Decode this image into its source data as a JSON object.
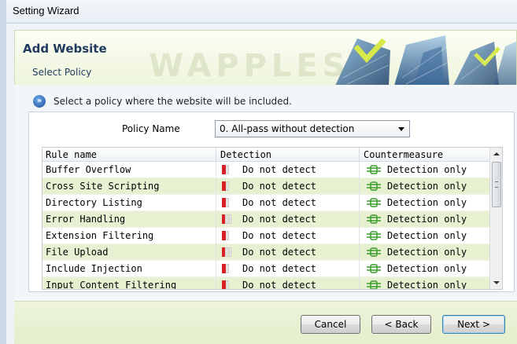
{
  "window": {
    "title": "Setting Wizard"
  },
  "header": {
    "title": "Add Website",
    "subtitle": "Select Policy",
    "watermark": "WAPPLES"
  },
  "info": {
    "text": "Select a policy where the website will be included."
  },
  "policy": {
    "label": "Policy Name",
    "selected": "0. All-pass without detection"
  },
  "table": {
    "columns": [
      "Rule name",
      "Detection",
      "Countermeasure"
    ],
    "rows": [
      {
        "name": "Buffer Overflow",
        "detection": "Do not detect",
        "countermeasure": "Detection only",
        "level": 2
      },
      {
        "name": "Cross Site Scripting",
        "detection": "Do not detect",
        "countermeasure": "Detection only",
        "level": 2
      },
      {
        "name": "Directory Listing",
        "detection": "Do not detect",
        "countermeasure": "Detection only",
        "level": 2
      },
      {
        "name": "Error Handling",
        "detection": "Do not detect",
        "countermeasure": "Detection only",
        "level": 3
      },
      {
        "name": "Extension Filtering",
        "detection": "Do not detect",
        "countermeasure": "Detection only",
        "level": 2
      },
      {
        "name": "File Upload",
        "detection": "Do not detect",
        "countermeasure": "Detection only",
        "level": 3
      },
      {
        "name": "Include Injection",
        "detection": "Do not detect",
        "countermeasure": "Detection only",
        "level": 2
      },
      {
        "name": "Input Content Filtering",
        "detection": "Do not detect",
        "countermeasure": "Detection only",
        "level": 2
      }
    ]
  },
  "buttons": {
    "cancel": "Cancel",
    "back": "< Back",
    "next": "Next >"
  },
  "colors": {
    "accent": "#1f3a5e",
    "alt_row": "#e7f1d2",
    "detect_red": "#d81f26",
    "cm_green": "#3a9b2b"
  },
  "icons": {
    "info": "info-circle-icon",
    "detection": "detection-level-icon",
    "countermeasure": "countermeasure-icon"
  }
}
